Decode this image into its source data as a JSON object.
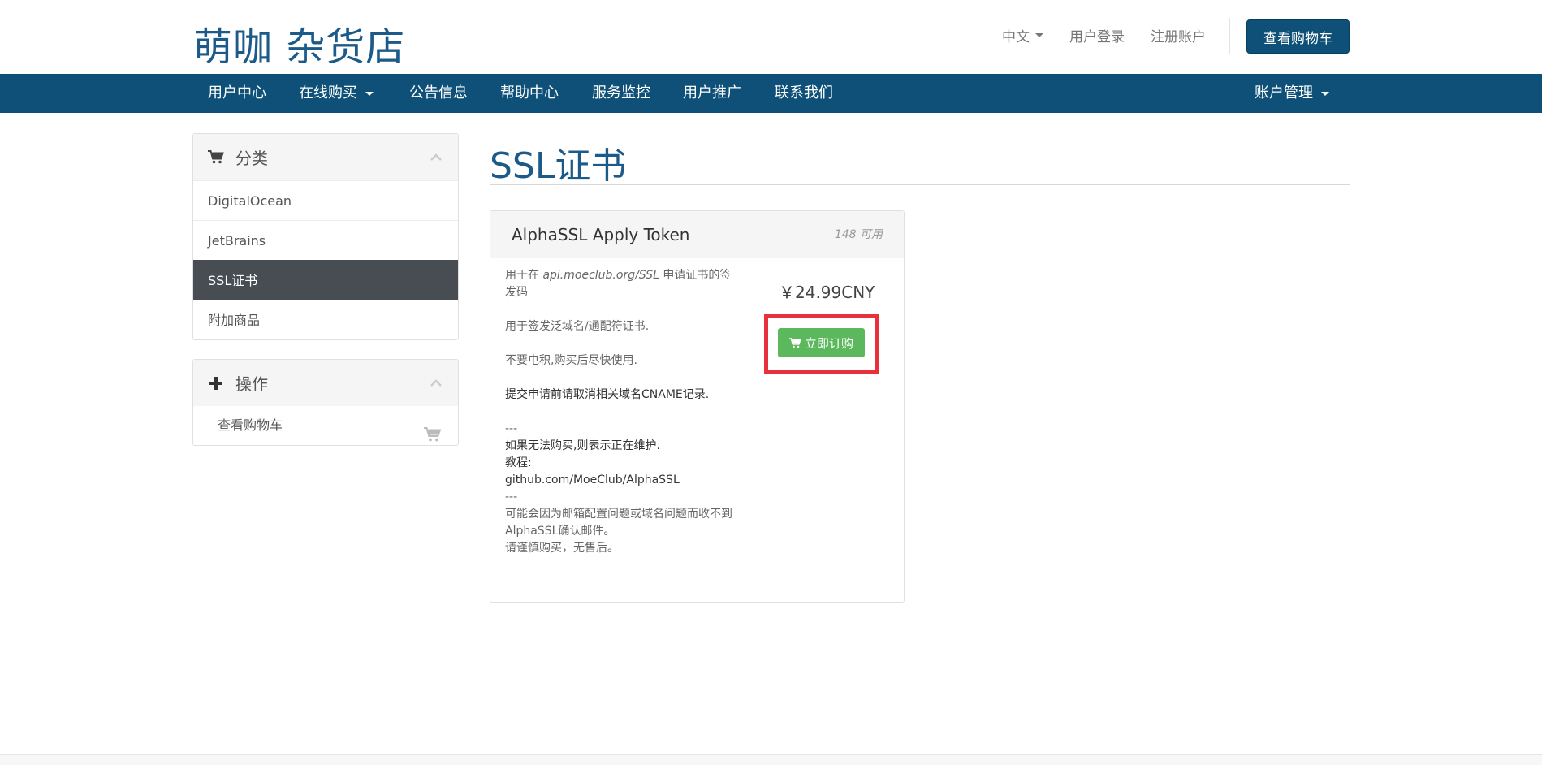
{
  "header": {
    "logo": "萌咖 杂货店",
    "language": "中文",
    "login": "用户登录",
    "register": "注册账户",
    "view_cart": "查看购物车"
  },
  "nav": {
    "items": [
      "用户中心",
      "在线购买",
      "公告信息",
      "帮助中心",
      "服务监控",
      "用户推广",
      "联系我们"
    ],
    "account": "账户管理"
  },
  "sidebar": {
    "categories_title": "分类",
    "categories": [
      "DigitalOcean",
      "JetBrains",
      "SSL证书",
      "附加商品"
    ],
    "active_category": "SSL证书",
    "actions_title": "操作",
    "actions": [
      "查看购物车"
    ]
  },
  "main": {
    "page_title": "SSL证书",
    "product": {
      "name": "AlphaSSL Apply Token",
      "stock": "148 可用",
      "desc_line1_pre": "用于在 ",
      "desc_line1_link": "api.moeclub.org/SSL",
      "desc_line1_post": " 申请证书的签发码",
      "desc_line2": "用于签发泛域名/通配符证书.",
      "desc_line3": "不要屯积,购买后尽快使用.",
      "desc_line4": "提交申请前请取消相关域名CNAME记录.",
      "desc_sep1": "---",
      "desc_line5": "如果无法购买,则表示正在维护.",
      "desc_line6": "教程:",
      "desc_line7": "github.com/MoeClub/AlphaSSL",
      "desc_sep2": "---",
      "desc_line8": "可能会因为邮箱配置问题或域名问题而收不到AlphaSSL确认邮件。",
      "desc_line9": "请谨慎购买，无售后。",
      "price": "￥24.99CNY",
      "order_button": "立即订购"
    }
  },
  "colors": {
    "brand": "#0e5077",
    "logo": "#1c5a8a",
    "order_button": "#5cb85c",
    "highlight": "#e8313a",
    "active_item": "#474d52"
  }
}
